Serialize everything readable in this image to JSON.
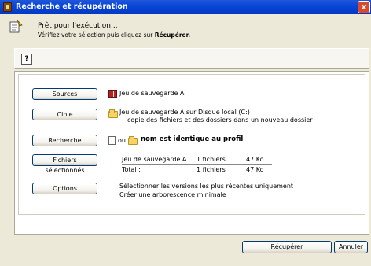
{
  "window": {
    "title": "Recherche et récupération",
    "close_label": "x"
  },
  "header": {
    "title": "Prêt pour l'exécution...",
    "subtitle": "Vérifiez votre sélection puis cliquez sur",
    "subtitle_bold": "Récupérer."
  },
  "toolbar": {
    "help_label": "?"
  },
  "rows": {
    "sources": {
      "button": "Sources",
      "text": "Jeu de sauvegarde A"
    },
    "cible": {
      "button": "Cible",
      "text": "Jeu de sauvegarde A sur Disque local (C:)",
      "text2": "copie des fichiers et des dossiers dans un nouveau dossier"
    },
    "recherche": {
      "button": "Recherche",
      "ou": "ou",
      "text": "nom est identique au profil"
    },
    "fichiers": {
      "button": "Fichiers sélectionnés",
      "rows": [
        {
          "name": "Jeu de sauvegarde A",
          "count": "1 fichiers",
          "size": "47 Ko"
        },
        {
          "name": "Total :",
          "count": "1 fichiers",
          "size": "47 Ko"
        }
      ]
    },
    "options": {
      "button": "Options",
      "line1": "Sélectionner les versions les plus récentes uniquement",
      "line2": "Créer une arborescence minimale"
    }
  },
  "footer": {
    "recuperer": "Récupérer",
    "annuler": "Annuler"
  },
  "colors": {
    "titlebar": "#0A46D7",
    "dialog_bg": "#ECE9D8",
    "button_border": "#003C74"
  }
}
